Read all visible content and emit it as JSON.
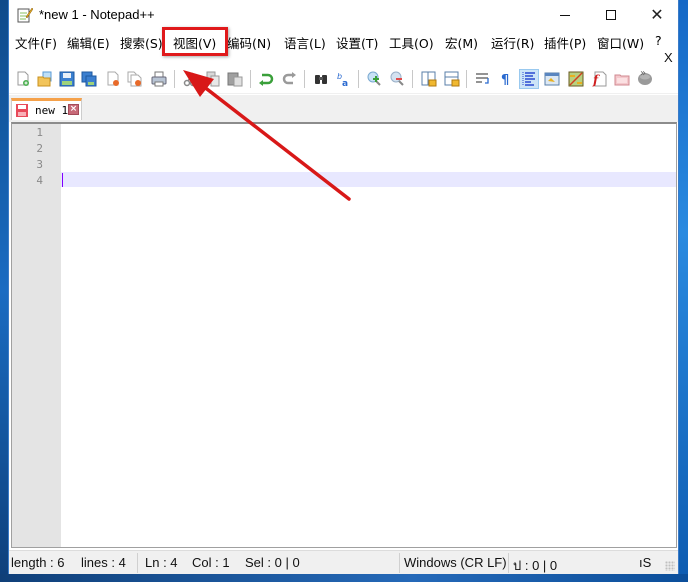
{
  "window": {
    "title": "*new 1 - Notepad++",
    "controls": {
      "minimize_icon": "minimize-icon",
      "maximize_icon": "maximize-icon",
      "close_glyph": "✕"
    }
  },
  "menu": {
    "items": [
      {
        "label": "文件(F)"
      },
      {
        "label": "编辑(E)"
      },
      {
        "label": "搜索(S)"
      },
      {
        "label": "视图(V)"
      },
      {
        "label": "编码(N)"
      },
      {
        "label": "语言(L)"
      },
      {
        "label": "设置(T)"
      },
      {
        "label": "工具(O)"
      },
      {
        "label": "宏(M)"
      },
      {
        "label": "运行(R)"
      },
      {
        "label": "插件(P)"
      },
      {
        "label": "窗口(W)"
      },
      {
        "label": "?"
      }
    ],
    "close_doc_label": "X",
    "highlighted_item": "视图(V)"
  },
  "toolbar": {
    "buttons": [
      {
        "name": "new-file",
        "icon": "new-file-icon"
      },
      {
        "name": "open-file",
        "icon": "open-folder-icon"
      },
      {
        "name": "save",
        "icon": "save-icon"
      },
      {
        "name": "save-all",
        "icon": "save-all-icon"
      },
      {
        "name": "close",
        "icon": "close-file-icon"
      },
      {
        "name": "close-all",
        "icon": "close-all-icon"
      },
      {
        "name": "print",
        "icon": "print-icon"
      },
      {
        "name": "cut",
        "icon": "cut-icon"
      },
      {
        "name": "copy",
        "icon": "copy-icon"
      },
      {
        "name": "paste",
        "icon": "paste-icon"
      },
      {
        "name": "undo",
        "icon": "undo-icon"
      },
      {
        "name": "redo",
        "icon": "redo-icon"
      },
      {
        "name": "find",
        "icon": "find-binoculars-icon"
      },
      {
        "name": "replace",
        "icon": "replace-icon"
      },
      {
        "name": "zoom-in",
        "icon": "zoom-in-icon"
      },
      {
        "name": "zoom-out",
        "icon": "zoom-out-icon"
      },
      {
        "name": "sync-vertical",
        "icon": "sync-vertical-icon"
      },
      {
        "name": "sync-horizontal",
        "icon": "sync-horizontal-icon"
      },
      {
        "name": "word-wrap",
        "icon": "word-wrap-icon"
      },
      {
        "name": "show-all-chars",
        "icon": "pilcrow-icon"
      },
      {
        "name": "indent-guide",
        "icon": "indent-guide-icon",
        "active": true
      },
      {
        "name": "user-defined-lang",
        "icon": "udl-icon"
      },
      {
        "name": "doc-map",
        "icon": "document-map-icon"
      },
      {
        "name": "function-list",
        "icon": "function-list-icon"
      },
      {
        "name": "folder-workspace",
        "icon": "folder-workspace-icon"
      },
      {
        "name": "monitoring",
        "icon": "monitoring-icon"
      }
    ],
    "more_label": "»"
  },
  "tabs": [
    {
      "label": "new 1",
      "unsaved": true,
      "active": true
    }
  ],
  "editor": {
    "line_numbers": [
      "1",
      "2",
      "3",
      "4"
    ],
    "current_line": 4
  },
  "statusbar": {
    "length": "length : 6",
    "lines": "lines : 4",
    "ln": "Ln : 4",
    "col": "Col : 1",
    "sel": "Sel : 0 | 0",
    "eol": "Windows (CR LF)",
    "encoding_partial": "ป : 0 | 0",
    "mode_partial": "ıS"
  },
  "annotation": {
    "color": "#e0191b",
    "target": "视图(V)"
  }
}
